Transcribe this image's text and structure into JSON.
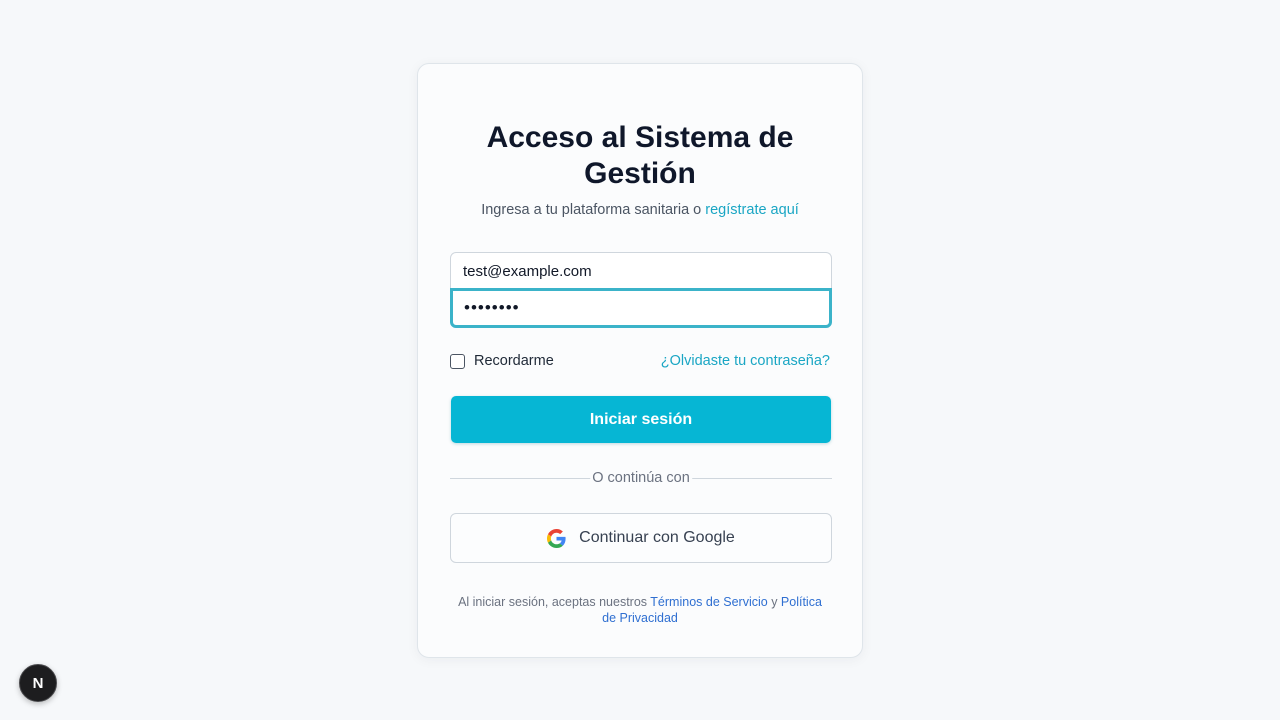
{
  "login": {
    "title": "Acceso al Sistema de Gestión",
    "subtitle_prefix": "Ingresa a tu plataforma sanitaria o",
    "register_link": "regístrate aquí",
    "email_value": "test@example.com",
    "password_value": "password",
    "remember_label": "Recordarme",
    "remember_checked": false,
    "forgot_link": "¿Olvidaste tu contraseña?",
    "submit_label": "Iniciar sesión",
    "divider_text": "O continúa con",
    "google_label": "Continuar con Google",
    "legal_prefix": "Al iniciar sesión, aceptas nuestros",
    "terms_link": "Términos de Servicio",
    "legal_and": "y",
    "privacy_link": "Política de Privacidad"
  },
  "dev_badge": {
    "letter": "N",
    "icon": "nextjs-logo-icon"
  },
  "colors": {
    "accent": "#06b6d4",
    "link": "#1aa6c4",
    "legal_link": "#2f6fd1",
    "background": "#f6f8fa"
  }
}
